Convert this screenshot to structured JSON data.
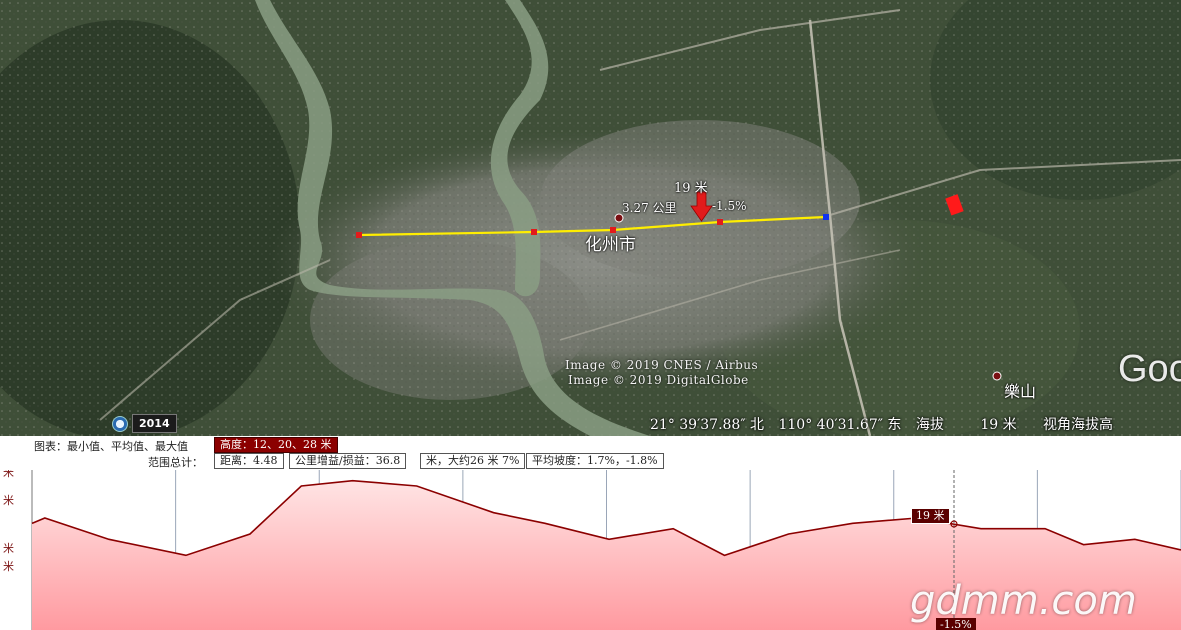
{
  "map": {
    "labels": {
      "city": "化州市",
      "town": "樂山",
      "path_elev": "19 米",
      "path_info_a": "3.27 公里",
      "path_info_b": "-1.5%"
    },
    "credits": [
      "Image © 2019 CNES / Airbus",
      "Image © 2019 DigitalGlobe"
    ],
    "year": "2014",
    "logo_text": "Goo",
    "status": {
      "lat": "21° 39′37.88″ 北",
      "lon": "110° 40′31.67″ 东",
      "elev_label": "海拔",
      "elev_value": "19 米",
      "eye_label": "视角海拔高"
    },
    "colors": {
      "path": "#ffee00",
      "marker": "#e21b1b",
      "end_marker": "#1133ee"
    }
  },
  "profile": {
    "header": {
      "chart_label": "图表：最小值、平均值、最大值",
      "height_box": "高度：12、20、28 米",
      "range_label": "范围总计：",
      "distance": "距离：4.48",
      "gain_loss": "公里增益/损益：36.8",
      "slope_max": "米，大约26 米 7%",
      "slope_avg": "平均坡度：1.7%，-1.8%"
    },
    "y_ticks": [
      "米",
      "米",
      "米",
      "米"
    ],
    "cursor_elev": "19 米",
    "cursor_slope": "-1.5%",
    "watermark": "gdmm.com",
    "colors": {
      "line": "#8b0000",
      "fill_top": "#ffd6d6",
      "fill_bottom": "#ff9aa0",
      "grid": "#9aa6b8"
    }
  },
  "chart_data": {
    "type": "area",
    "title": "",
    "xlabel": "",
    "ylabel": "米",
    "xlim": [
      0,
      4.48
    ],
    "ylim": [
      0,
      30
    ],
    "series": [
      {
        "x": [
          0.0,
          0.05,
          0.3,
          0.6,
          0.85,
          1.05,
          1.25,
          1.5,
          1.8,
          2.0,
          2.25,
          2.5,
          2.7,
          2.95,
          3.2,
          3.45,
          3.7,
          3.95,
          4.1,
          4.3,
          4.48
        ],
        "values": [
          20,
          21,
          17,
          14,
          18,
          27,
          28,
          27,
          22,
          20,
          17,
          19,
          14,
          18,
          20,
          21,
          19,
          19,
          16,
          17,
          15
        ]
      }
    ]
  }
}
